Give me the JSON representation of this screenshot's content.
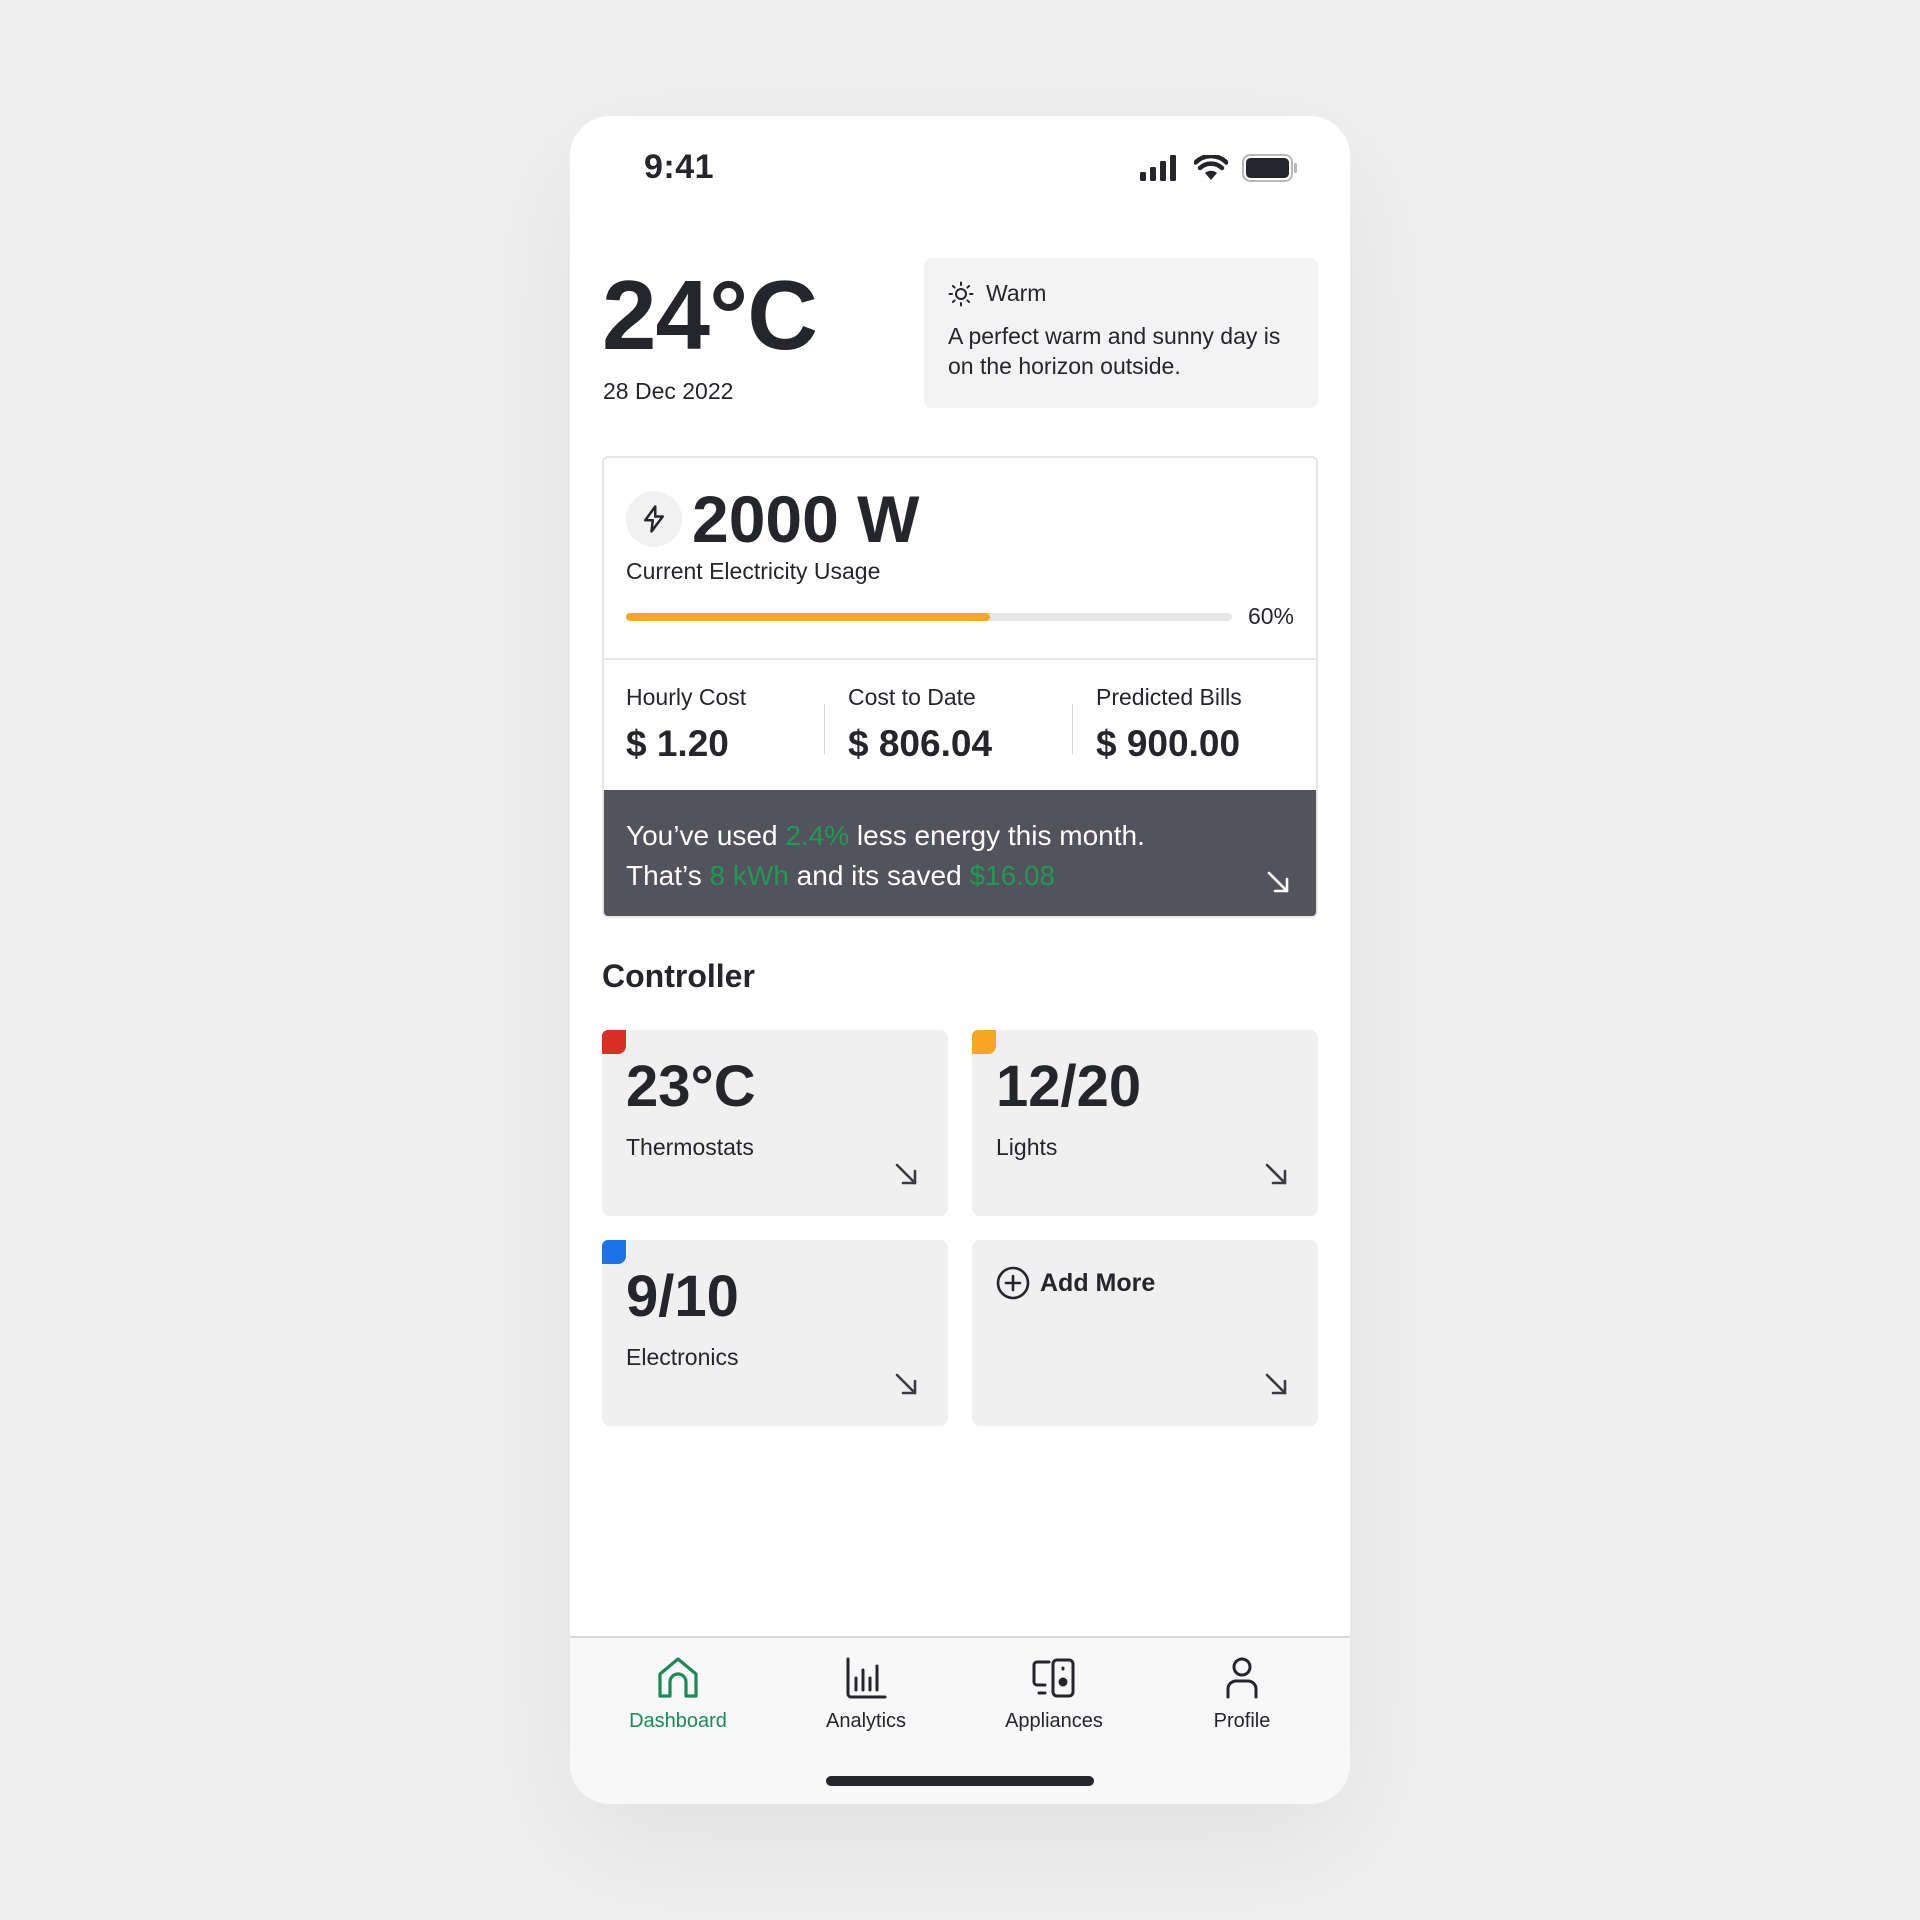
{
  "status_bar": {
    "time": "9:41",
    "icons": [
      "cellular-signal-icon",
      "wifi-icon",
      "battery-icon"
    ]
  },
  "header": {
    "temperature": "24°C",
    "date": "28 Dec 2022",
    "weather": {
      "icon": "sun-icon",
      "title": "Warm",
      "description": "A perfect warm and sunny day is on the horizon outside."
    }
  },
  "electricity": {
    "icon": "lightning-bolt-icon",
    "value": "2000 W",
    "label": "Current Electricity Usage",
    "progress_percent": 60,
    "progress_label": "60%",
    "progress_color": "#f9a825",
    "costs": [
      {
        "label": "Hourly Cost",
        "value": "$ 1.20"
      },
      {
        "label": "Cost to Date",
        "value": "$ 806.04"
      },
      {
        "label": "Predicted Bills",
        "value": "$ 900.00"
      }
    ],
    "savings": {
      "line1_prefix": "You’ve used ",
      "line1_highlight": "2.4%",
      "line1_suffix": " less energy this month.",
      "line2_prefix": "That’s ",
      "line2_highlight1": "8 kWh",
      "line2_middle": " and its saved ",
      "line2_highlight2": "$16.08",
      "highlight_color": "#1f9a55",
      "arrow_icon": "arrow-down-right-icon"
    }
  },
  "controller": {
    "title": "Controller",
    "tiles": [
      {
        "value": "23°C",
        "label": "Thermostats",
        "color": "#d93025"
      },
      {
        "value": "12/20",
        "label": "Lights",
        "color": "#f5a623"
      },
      {
        "value": "9/10",
        "label": "Electronics",
        "color": "#1a73e8"
      }
    ],
    "add_more": {
      "label": "Add More",
      "icon": "plus-circle-icon"
    }
  },
  "bottom_nav": {
    "active_color": "#1a8b54",
    "items": [
      {
        "label": "Dashboard",
        "icon": "home-icon",
        "active": true
      },
      {
        "label": "Analytics",
        "icon": "bar-chart-icon",
        "active": false
      },
      {
        "label": "Appliances",
        "icon": "devices-icon",
        "active": false
      },
      {
        "label": "Profile",
        "icon": "user-icon",
        "active": false
      }
    ]
  }
}
